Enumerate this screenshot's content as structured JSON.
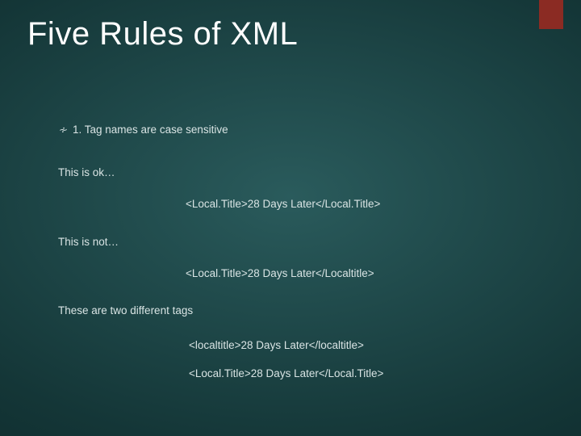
{
  "title": "Five Rules of XML",
  "bullet": {
    "text": "1. Tag names are case sensitive"
  },
  "section1": {
    "label": "This is ok…",
    "code": "<Local.Title>28 Days Later</Local.Title>"
  },
  "section2": {
    "label": "This is not…",
    "code": "<Local.Title>28 Days Later</Localtitle>"
  },
  "section3": {
    "label": "These are two different tags",
    "code1": "<localtitle>28 Days Later</localtitle>",
    "code2": "<Local.Title>28 Days Later</Local.Title>"
  }
}
